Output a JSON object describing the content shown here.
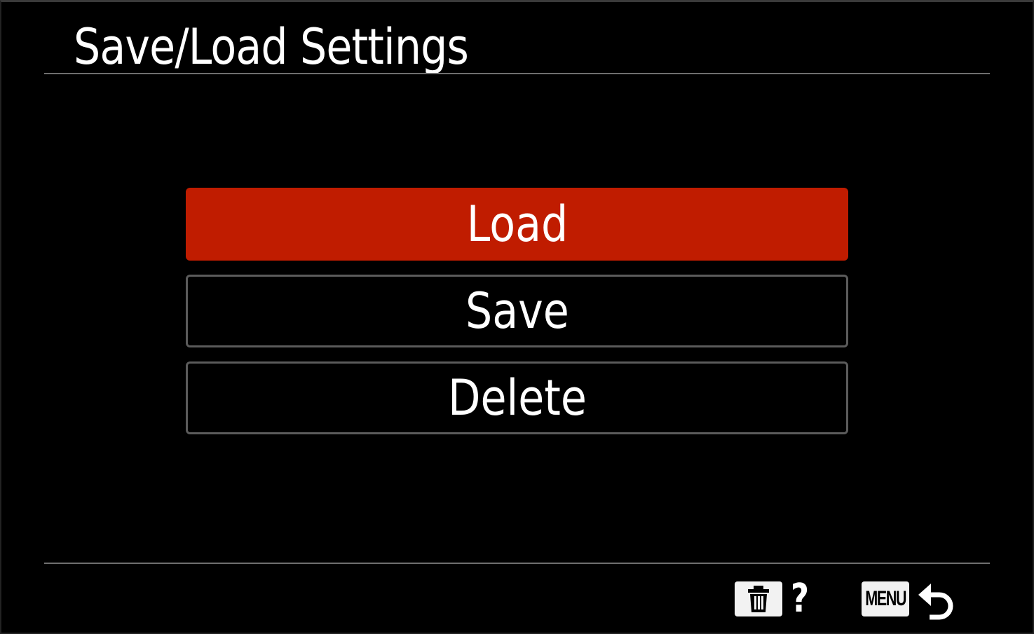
{
  "header": {
    "title": "Save/Load Settings"
  },
  "menu": {
    "items": [
      {
        "label": "Load",
        "selected": true
      },
      {
        "label": "Save",
        "selected": false
      },
      {
        "label": "Delete",
        "selected": false
      }
    ]
  },
  "footer": {
    "trash_icon": "trash-icon",
    "help_label": "?",
    "menu_button_label": "MENU",
    "back_icon": "back-arrow-icon"
  },
  "colors": {
    "background": "#000000",
    "selected_item": "#c01c00",
    "item_border": "#5b5b5b",
    "divider": "#6f6f6f",
    "text": "#ffffff"
  }
}
